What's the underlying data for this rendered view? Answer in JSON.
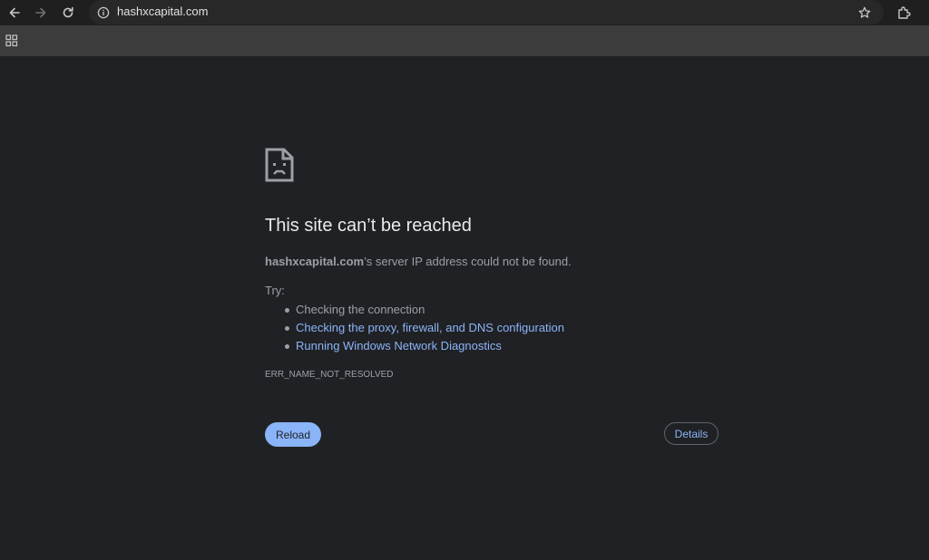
{
  "browser": {
    "url": "hashxcapital.com",
    "icons": {
      "back": "arrow-left-icon",
      "forward": "arrow-right-icon",
      "reload": "reload-icon",
      "site_info": "info-icon",
      "bookmark": "star-icon",
      "extensions": "puzzle-icon",
      "apps": "apps-grid-icon"
    }
  },
  "error_page": {
    "icon": "sad-file-icon",
    "headline": "This site can’t be reached",
    "host": "hashxcapital.com",
    "message_suffix": "’s server IP address could not be found.",
    "try_label": "Try:",
    "suggestions": [
      "Checking the connection",
      "Checking the proxy, firewall, and DNS configuration",
      "Running Windows Network Diagnostics"
    ],
    "error_code": "ERR_NAME_NOT_RESOLVED",
    "reload_label": "Reload",
    "details_label": "Details"
  },
  "colors": {
    "background": "#202124",
    "headline": "#e8eaed",
    "text": "#9aa0a6",
    "link": "#8ab4f8",
    "button_primary": "#8ab4f8"
  }
}
